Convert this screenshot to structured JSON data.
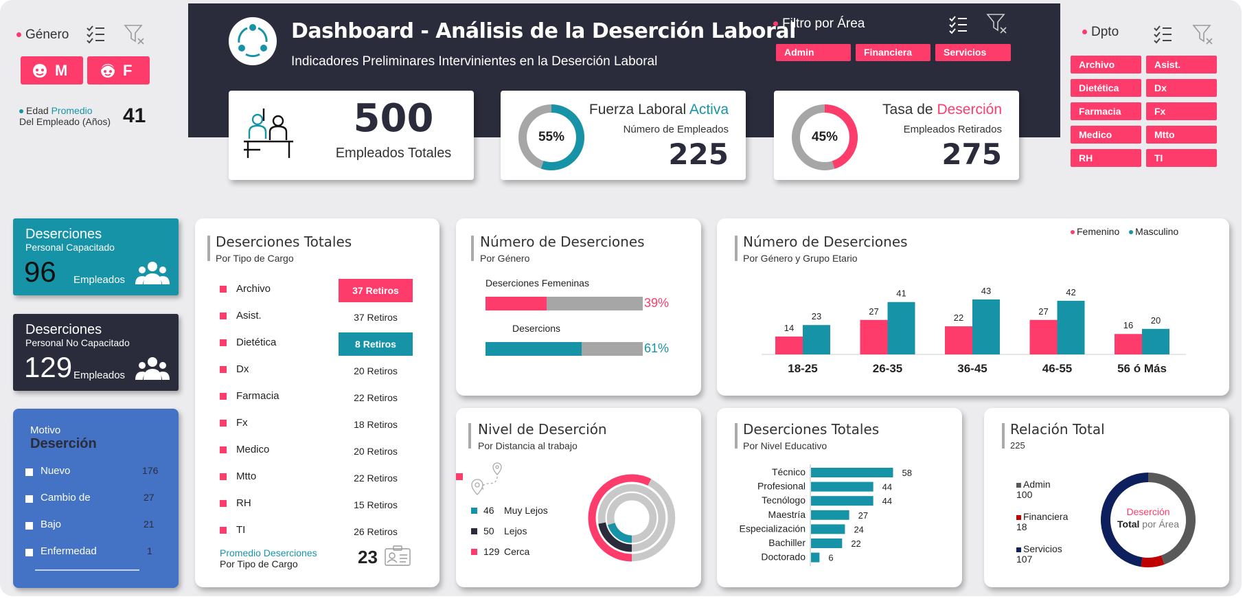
{
  "colors": {
    "pink": "#fe3c6c",
    "teal": "#1793a8",
    "dark": "#2b2c3b",
    "grey": "#a6a6a6",
    "blue": "#4472c4",
    "navy": "#0d1f5c",
    "red": "#c00000",
    "dgrey": "#595959"
  },
  "genero": {
    "label": "Género",
    "btn_m": "M",
    "btn_f": "F",
    "edad_label": "Edad",
    "edad_prom": "Promedio",
    "edad_sub": "Del Empleado (Años)",
    "edad_value": "41"
  },
  "header": {
    "title": "Dashboard - Análisis de la Deserción Laboral",
    "subtitle": "Indicadores Preliminares Intervinientes en la Deserción Laboral"
  },
  "area_filter": {
    "label": "Filtro por Área",
    "items": [
      "Admin",
      "Financiera",
      "Servicios"
    ]
  },
  "dpto": {
    "label": "Dpto",
    "items": [
      "Archivo",
      "Asist.",
      "Dietética",
      "Dx",
      "Farmacia",
      "Fx",
      "Medico",
      "Mtto",
      "RH",
      "TI"
    ]
  },
  "kpi_total": {
    "value": "500",
    "label": "Empleados Totales"
  },
  "kpi_activa": {
    "title_a": "Fuerza Laboral",
    "title_b": "Activa",
    "sub": "Número de Empleados",
    "value": "225",
    "pct_label": "55%",
    "pct": 55
  },
  "kpi_desercion": {
    "title_a": "Tasa de",
    "title_b": "Deserción",
    "sub": "Empleados Retirados",
    "value": "275",
    "pct_label": "45%",
    "pct": 45
  },
  "cap": {
    "title": "Deserciones",
    "sub": "Personal Capacitado",
    "value": "96",
    "unit": "Empleados"
  },
  "nocap": {
    "title": "Deserciones",
    "sub": "Personal No Capacitado",
    "value": "129",
    "unit": "Empleados"
  },
  "motivo": {
    "label": "Motivo",
    "title": "Deserción",
    "items": [
      {
        "name": "Nuevo",
        "value": "176"
      },
      {
        "name": "Cambio de",
        "value": "27"
      },
      {
        "name": "Bajo",
        "value": "21"
      },
      {
        "name": "Enfermedad",
        "value": "1"
      }
    ]
  },
  "cargo": {
    "title": "Deserciones Totales",
    "sub": "Por Tipo de Cargo",
    "rows": [
      {
        "name": "Archivo",
        "value": "37 Retiros"
      },
      {
        "name": "Asist.",
        "value": "37 Retiros"
      },
      {
        "name": "Dietética",
        "value": "8 Retiros"
      },
      {
        "name": "Dx",
        "value": "20 Retiros"
      },
      {
        "name": "Farmacia",
        "value": "22 Retiros"
      },
      {
        "name": "Fx",
        "value": "18 Retiros"
      },
      {
        "name": "Medico",
        "value": "20 Retiros"
      },
      {
        "name": "Mtto",
        "value": "22 Retiros"
      },
      {
        "name": "RH",
        "value": "15 Retiros"
      },
      {
        "name": "TI",
        "value": "26 Retiros"
      }
    ],
    "prom_label": "Promedio Deserciones",
    "prom_sub": "Por Tipo de Cargo",
    "prom_value": "23"
  },
  "genero_chart": {
    "title": "Número de Deserciones",
    "sub": "Por Género",
    "fem_label": "Deserciones Femeninas",
    "fem_pct_label": "39%",
    "fem_pct": 39,
    "mas_label": "Desercions",
    "mas_pct_label": "61%",
    "mas_pct": 61
  },
  "etario": {
    "title": "Número de Deserciones",
    "sub": "Por Género y Grupo Etario",
    "legend_f": "Femenino",
    "legend_m": "Masculino"
  },
  "nivel": {
    "title": "Nivel de Deserción",
    "sub": "Por Distancia al trabajo",
    "items": [
      {
        "value": "46",
        "name": "Muy Lejos"
      },
      {
        "value": "50",
        "name": "Lejos"
      },
      {
        "value": "129",
        "name": "Cerca"
      }
    ]
  },
  "educ": {
    "title": "Deserciones Totales",
    "sub": "Por Nivel Educativo"
  },
  "relacion": {
    "title": "Relación Total",
    "total": "225",
    "center_a": "Deserción",
    "center_b": "Total",
    "center_c": "por Área",
    "items": [
      {
        "name": "Admin",
        "value": "100"
      },
      {
        "name": "Financiera",
        "value": "18"
      },
      {
        "name": "Servicios",
        "value": "107"
      }
    ]
  },
  "chart_data": [
    {
      "type": "bar",
      "title": "Número de Deserciones",
      "subtitle": "Por Género y Grupo Etario",
      "categories": [
        "18-25",
        "26-35",
        "36-45",
        "46-55",
        "56 ó Más"
      ],
      "series": [
        {
          "name": "Femenino",
          "values": [
            14,
            27,
            22,
            27,
            16
          ]
        },
        {
          "name": "Masculino",
          "values": [
            23,
            41,
            43,
            42,
            20
          ]
        }
      ]
    },
    {
      "type": "bar",
      "title": "Deserciones Totales",
      "subtitle": "Por Nivel Educativo",
      "categories": [
        "Técnico",
        "Profesional",
        "Tecnólogo",
        "Maestría",
        "Especialización",
        "Bachiller",
        "Doctorado"
      ],
      "values": [
        58,
        44,
        44,
        27,
        24,
        22,
        6
      ]
    },
    {
      "type": "pie",
      "title": "Relación Total",
      "categories": [
        "Admin",
        "Financiera",
        "Servicios"
      ],
      "values": [
        100,
        18,
        107
      ]
    },
    {
      "type": "pie",
      "title": "Nivel de Deserción",
      "categories": [
        "Muy Lejos",
        "Lejos",
        "Cerca"
      ],
      "values": [
        46,
        50,
        129
      ]
    }
  ]
}
